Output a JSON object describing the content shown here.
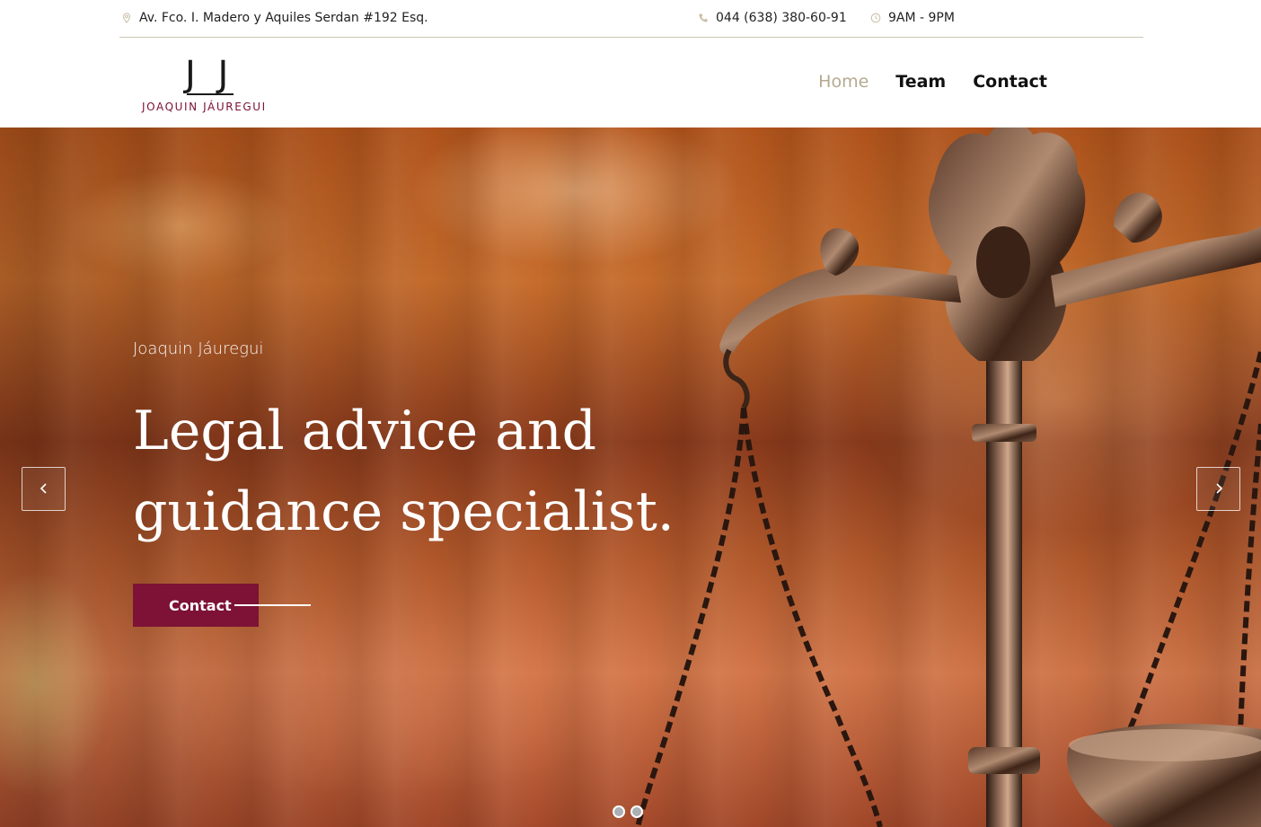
{
  "topbar": {
    "address": "Av. Fco. I. Madero y Aquiles Serdan #192 Esq.",
    "address_icon": "map-pin-icon",
    "phone": "044 (638) 380-60-91",
    "phone_icon": "phone-icon",
    "hours": "9AM - 9PM",
    "hours_icon": "clock-icon"
  },
  "logo": {
    "mark": "J J",
    "name": "JOAQUIN JÁUREGUI"
  },
  "nav": {
    "items": [
      {
        "label": "Home",
        "active": true
      },
      {
        "label": "Team",
        "active": false
      },
      {
        "label": "Contact",
        "active": false
      }
    ]
  },
  "hero": {
    "kicker": "Joaquin Jáuregui",
    "title": "Legal advice and guidance specialist.",
    "cta_label": "Contact",
    "prev_icon": "chevron-left-icon",
    "next_icon": "chevron-right-icon",
    "slide_count": 2,
    "active_slide": 1
  },
  "colors": {
    "brand": "#7d1236",
    "nav_active": "#b5aa90",
    "divider": "#cfc6b4"
  }
}
